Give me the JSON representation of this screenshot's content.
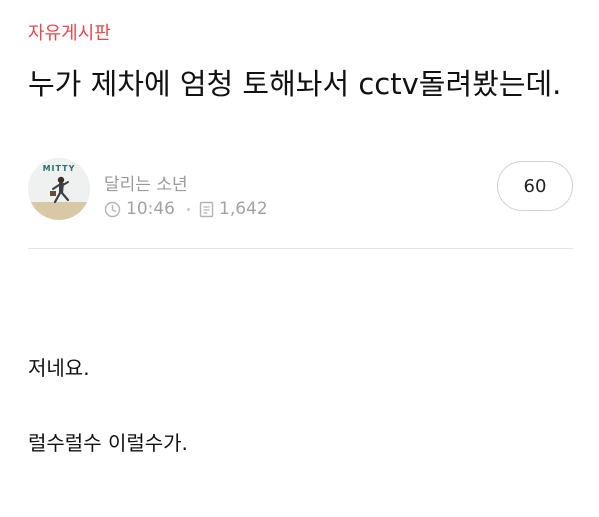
{
  "board": {
    "name": "자유게시판"
  },
  "post": {
    "title": "누가 제차에 엄청 토해놔서 cctv돌려봤는데.",
    "author": "달리는 소년",
    "time": "10:46",
    "views": "1,642",
    "comment_count": "60",
    "body": [
      "저네요.",
      "럴수럴수 이럴수가."
    ]
  },
  "avatar": {
    "caption": "MITTY"
  },
  "colors": {
    "board_accent": "#e5484d",
    "meta_text": "#a2a2a2",
    "divider": "#e6e6e6"
  },
  "icons": {
    "time": "clock-icon",
    "views": "document-icon"
  }
}
